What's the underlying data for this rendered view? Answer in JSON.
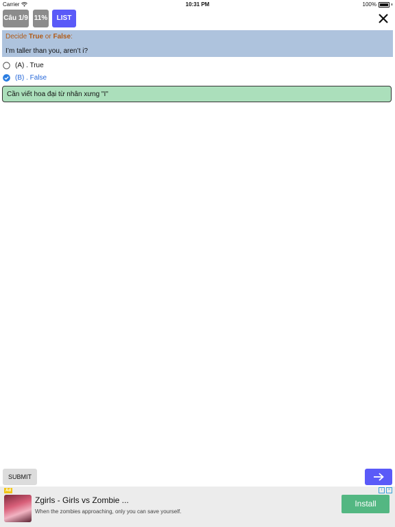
{
  "status_bar": {
    "carrier": "Carrier",
    "time": "10:31 PM",
    "battery": "100%",
    "battery_level": 1.0
  },
  "toolbar": {
    "question_counter": "Câu 1/9",
    "progress": "11%",
    "list_label": "LIST",
    "close_icon": "close-icon",
    "accent_color": "#5a5af8"
  },
  "question": {
    "instruction_prefix": "Decide ",
    "instruction_true": "True",
    "instruction_or": " or ",
    "instruction_false": "False",
    "instruction_suffix": ":",
    "text": "I’m taller than you, aren’t i?"
  },
  "options": [
    {
      "label": "(A) . True",
      "selected": false
    },
    {
      "label": "(B) . False",
      "selected": true
    }
  ],
  "explanation": "Cần viết hoa đại từ nhân xưng \"I\"",
  "actions": {
    "submit_label": "SUBMIT",
    "next_icon": "arrow-right-icon"
  },
  "ad": {
    "badge": "Ad",
    "title": "Zgirls - Girls vs Zombie ...",
    "description": "When the zombies approaching, only you can save yourself.",
    "install_label": "Install",
    "install_color": "#53b782"
  }
}
